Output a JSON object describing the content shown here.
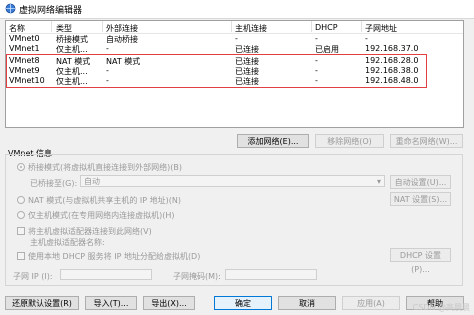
{
  "window": {
    "title": "虚拟网络编辑器"
  },
  "table": {
    "headers": [
      "名称",
      "类型",
      "外部连接",
      "主机连接",
      "DHCP",
      "子网地址"
    ],
    "rows": [
      [
        "VMnet0",
        "桥接模式",
        "自动桥接",
        "-",
        "-",
        "-"
      ],
      [
        "VMnet1",
        "仅主机...",
        "-",
        "已连接",
        "已启用",
        "192.168.37.0"
      ],
      [
        "VMnet8",
        "NAT 模式",
        "NAT 模式",
        "已连接",
        "-",
        "192.168.28.0"
      ],
      [
        "VMnet9",
        "仅主机...",
        "-",
        "已连接",
        "-",
        "192.168.38.0"
      ],
      [
        "VMnet10",
        "仅主机...",
        "-",
        "已连接",
        "-",
        "192.168.48.0"
      ]
    ]
  },
  "table_buttons": {
    "add_network": "添加网络(E)...",
    "remove_network": "移除网络(O)",
    "rename_network": "重命名网络(W)..."
  },
  "vmnet_info": {
    "title": "VMnet 信息",
    "bridged_label": "桥接模式(将虚拟机直接连接到外部网络)(B)",
    "bridged_to_label": "已桥接至(G):",
    "bridged_to_value": "自动",
    "auto_settings_button": "自动设置(U)...",
    "nat_label": "NAT 模式(与虚拟机共享主机的 IP 地址)(N)",
    "nat_settings_button": "NAT 设置(S)...",
    "hostonly_label": "仅主机模式(在专用网络内连接虚拟机)(H)",
    "connect_adapter_label": "将主机虚拟适配器连接到此网络(V)",
    "adapter_name_label": "主机虚拟适配器名称:",
    "dhcp_label": "使用本地 DHCP 服务将 IP 地址分配给虚拟机(D)",
    "dhcp_settings_button": "DHCP 设置(P)...",
    "subnet_ip_label": "子网 IP (I):",
    "subnet_mask_label": "子网掩码(M):"
  },
  "bottom_buttons": {
    "restore_defaults": "还原默认设置(R)",
    "import": "导入(T)...",
    "export": "导出(X)...",
    "ok": "确定",
    "cancel": "取消",
    "apply": "应用(A)",
    "help": "帮助"
  },
  "watermark": "CSDN @高晨晨",
  "colors": {
    "highlight_box": "#e04040",
    "primary_border": "#0078d7"
  }
}
